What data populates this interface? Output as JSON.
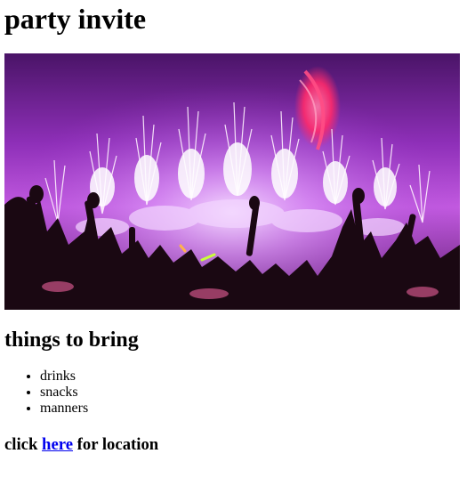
{
  "page": {
    "title": "party invite"
  },
  "hero_image": {
    "description_icon": "concert-photo",
    "colors": {
      "sky_top": "#6a1f8f",
      "sky_mid": "#b04ad6",
      "glow": "#f2d4ff",
      "crowd": "#1a0812",
      "stage_light": "#ff2a6b"
    }
  },
  "bring_section": {
    "heading": "things to bring",
    "items": [
      "drinks",
      "snacks",
      "manners"
    ]
  },
  "location": {
    "prefix": "click",
    "link_label": "here",
    "suffix": "for location",
    "link_color": "#0000ee"
  }
}
